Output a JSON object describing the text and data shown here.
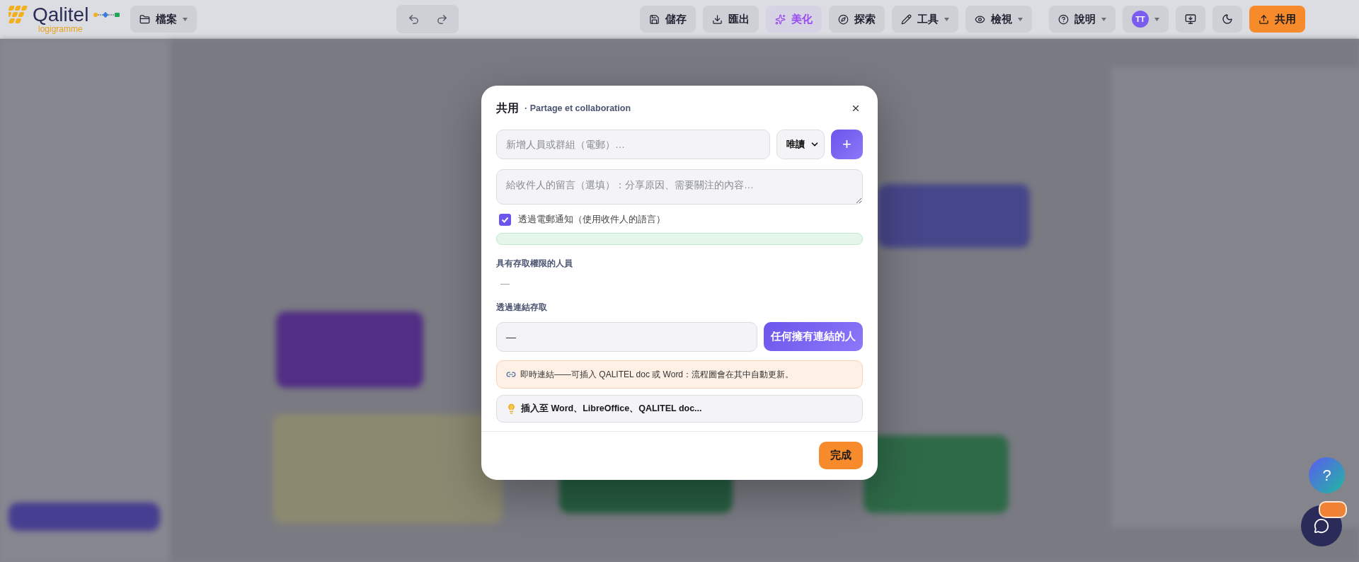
{
  "topbar": {
    "logo": {
      "name": "Qalitel",
      "tagline": "logigramme"
    },
    "file_menu": {
      "label": "檔案",
      "menu": true
    },
    "actions": [
      {
        "label": "儲存",
        "kind": "save",
        "menu": false,
        "active": false
      },
      {
        "label": "匯出",
        "kind": "export",
        "menu": false,
        "active": false
      },
      {
        "label": "美化",
        "kind": "beautify",
        "menu": false,
        "active": true
      },
      {
        "label": "探索",
        "kind": "explore",
        "menu": false,
        "active": false
      },
      {
        "label": "工具",
        "kind": "tools",
        "menu": true,
        "active": false
      },
      {
        "label": "檢視",
        "kind": "view",
        "menu": true,
        "active": false
      }
    ],
    "help": {
      "label": "說明",
      "menu": true
    },
    "user": {
      "initials": "TT",
      "menu": true
    },
    "share": {
      "label": "共用"
    }
  },
  "dialog": {
    "title": "共用",
    "subtitle": "· Partage et collaboration",
    "invite": {
      "placeholder": "新增人員或群組（電郵）…",
      "role": "唯讀",
      "add": "+"
    },
    "message": {
      "placeholder": "給收件人的留言（選填）：分享原因、需要關注的內容…"
    },
    "notify": {
      "label": "透過電郵通知（使用收件人的語言）",
      "checked": true
    },
    "people": {
      "heading": "具有存取權限的人員",
      "value": "—"
    },
    "link": {
      "heading": "透過連結存取",
      "value": "—",
      "access": "任何擁有連結的人"
    },
    "notice": "即時連結——可插入 QALITEL doc 或 Word：流程圖會在其中自動更新。",
    "tip": "插入至 Word、LibreOffice、QALITEL doc...",
    "done": "完成"
  },
  "floating": {
    "help": "?"
  }
}
